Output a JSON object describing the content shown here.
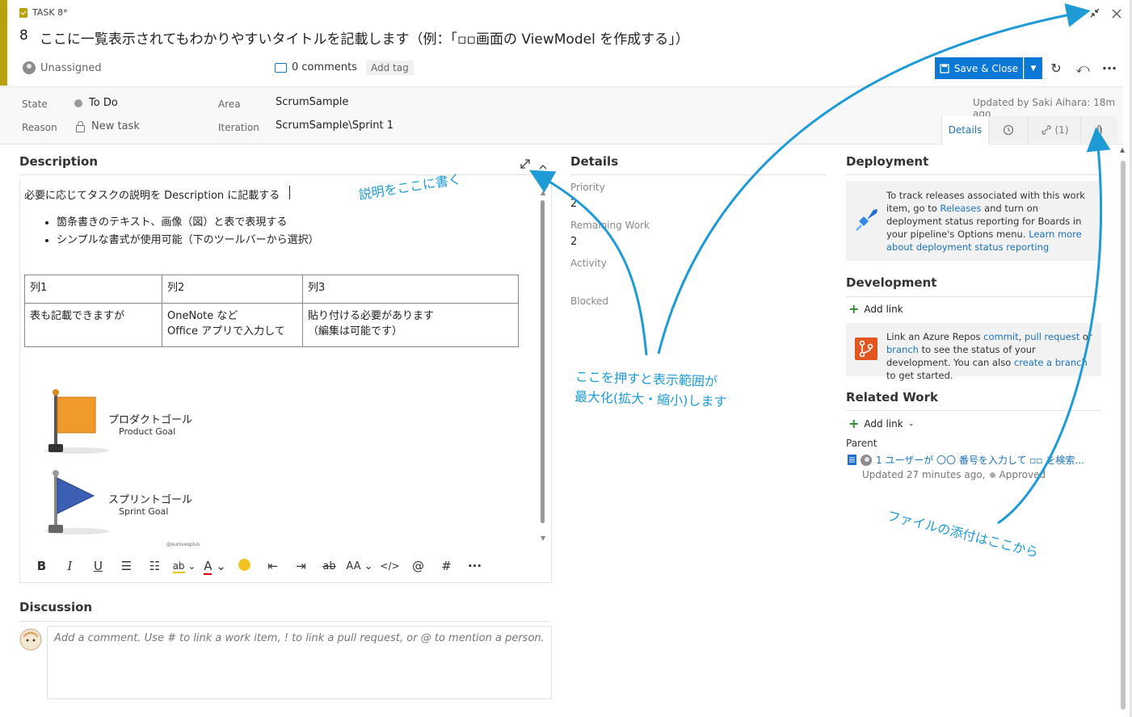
{
  "header": {
    "task_tag": "TASK 8*",
    "id": "8",
    "title": "ここに一覧表示されてもわかりやすいタイトルを記載します（例：「▫▫画面の ViewModel を作成する」）",
    "assignee": "Unassigned",
    "comments": "0 comments",
    "add_tag": "Add tag",
    "save_close": "Save & Close"
  },
  "fields": {
    "state_label": "State",
    "state_value": "To Do",
    "reason_label": "Reason",
    "reason_value": "New task",
    "area_label": "Area",
    "area_value": "ScrumSample",
    "iteration_label": "Iteration",
    "iteration_value": "ScrumSample\\Sprint 1",
    "updated": "Updated by Saki Aihara: 18m ago"
  },
  "tabs": {
    "details": "Details",
    "links": "(1)"
  },
  "description": {
    "heading": "Description",
    "line1": "必要に応じてタスクの説明を Description に記載する",
    "bullets": [
      "箇条書きのテキスト、画像（図）と表で表現する",
      "シンプルな書式が使用可能（下のツールバーから選択）"
    ],
    "table": [
      [
        "列1",
        "列2",
        "列3"
      ],
      [
        "表も記載できますが",
        "OneNote など\nOffice アプリで入力して",
        "貼り付ける必要があります\n（編集は可能です）"
      ]
    ],
    "flag1_jp": "プロダクトゴール",
    "flag1_en": "Product Goal",
    "flag2_jp": "スプリントゴール",
    "flag2_en": "Sprint Goal",
    "watermark": "@sunivesplus"
  },
  "discussion": {
    "heading": "Discussion",
    "placeholder": "Add a comment. Use # to link a work item, ! to link a pull request, or @ to mention a person."
  },
  "details": {
    "heading": "Details",
    "priority_label": "Priority",
    "priority_value": "2",
    "remaining_label": "Remaining Work",
    "remaining_value": "2",
    "activity_label": "Activity",
    "blocked_label": "Blocked"
  },
  "deployment": {
    "heading": "Deployment",
    "text1": "To track releases associated with this work item, go to ",
    "link1": "Releases",
    "text2": " and turn on deployment status reporting for Boards in your pipeline's Options menu. ",
    "link2": "Learn more about deployment status reporting"
  },
  "development": {
    "heading": "Development",
    "add_link": "Add link",
    "text1": "Link an Azure Repos ",
    "link_commit": "commit",
    "sep1": ", ",
    "link_pr": "pull request",
    "text2": " or ",
    "link_branch": "branch",
    "text3": " to see the status of your development. You can also ",
    "link_create": "create a branch",
    "text4": " to get started."
  },
  "related": {
    "heading": "Related Work",
    "add_link": "Add link",
    "parent_label": "Parent",
    "parent_title": "1 ユーザーが 〇〇 番号を入力して ▫▫ を検索...",
    "parent_meta": "Updated 27 minutes ago,",
    "parent_state": "Approved"
  },
  "annotations": {
    "write_here": "説明をここに書く",
    "maximize_line1": "ここを押すと表示範囲が",
    "maximize_line2": "最大化(拡大・縮小)します",
    "attach": "ファイルの添付はここから"
  },
  "colors": {
    "accent": "#b8a10f",
    "primary": "#0a78d4",
    "link": "#1b73b9",
    "annotation": "#1e9bd5"
  }
}
